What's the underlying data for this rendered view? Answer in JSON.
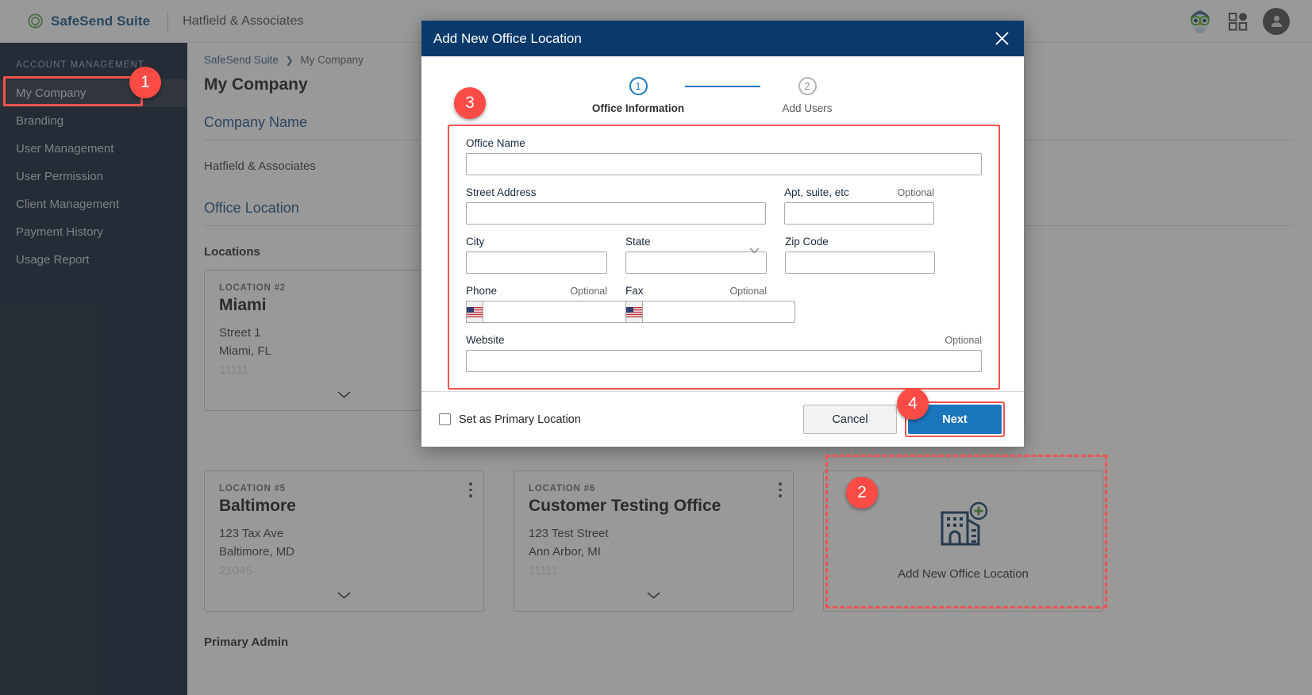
{
  "topbar": {
    "brand_name": "SafeSend Suite",
    "firm_name": "Hatfield & Associates",
    "icons": {
      "mascot": "owl-mascot-icon",
      "apps": "apps-grid-icon",
      "account": "user-avatar-icon"
    }
  },
  "sidebar": {
    "heading": "ACCOUNT MANAGEMENT",
    "items": [
      {
        "label": "My Company",
        "active": true
      },
      {
        "label": "Branding",
        "active": false
      },
      {
        "label": "User Management",
        "active": false
      },
      {
        "label": "User Permission",
        "active": false
      },
      {
        "label": "Client Management",
        "active": false
      },
      {
        "label": "Payment History",
        "active": false
      },
      {
        "label": "Usage Report",
        "active": false
      }
    ]
  },
  "main": {
    "breadcrumb": {
      "root": "SafeSend Suite",
      "separator": "❯",
      "current": "My Company"
    },
    "page_title": "My Company",
    "company_section_title": "Company Name",
    "company_value": "Hatfield & Associates",
    "office_section_title": "Office Location",
    "locations_label": "Locations",
    "primary_admin_label": "Primary Admin",
    "cards": [
      {
        "number": "LOCATION #2",
        "name": "Miami",
        "street": "Street 1",
        "city_state": "Miami, FL",
        "zip": "11111"
      },
      {
        "number": "LOCATION #5",
        "name": "Baltimore",
        "street": "123 Tax Ave",
        "city_state": "Baltimore, MD",
        "zip": "21045"
      },
      {
        "number": "LOCATION #6",
        "name": "Customer Testing Office",
        "street": "123 Test Street",
        "city_state": "Ann Arbor, MI",
        "zip": "11111"
      }
    ],
    "add_card": {
      "label": "Add New Office Location",
      "icon": "building-plus-icon"
    }
  },
  "modal": {
    "title": "Add New Office Location",
    "close_icon": "close-icon",
    "steps": [
      {
        "number": "1",
        "label": "Office Information",
        "state": "active"
      },
      {
        "number": "2",
        "label": "Add Users",
        "state": "pending"
      }
    ],
    "fields": {
      "office_name": {
        "label": "Office Name",
        "value": "",
        "optional": ""
      },
      "street": {
        "label": "Street Address",
        "value": "",
        "optional": ""
      },
      "apt": {
        "label": "Apt, suite, etc",
        "value": "",
        "optional": "Optional"
      },
      "city": {
        "label": "City",
        "value": "",
        "optional": ""
      },
      "state": {
        "label": "State",
        "value": "",
        "optional": ""
      },
      "zip": {
        "label": "Zip Code",
        "value": "",
        "optional": ""
      },
      "phone": {
        "label": "Phone",
        "value": "",
        "optional": "Optional",
        "country_flag": "us-flag-icon"
      },
      "fax": {
        "label": "Fax",
        "value": "",
        "optional": "Optional",
        "country_flag": "us-flag-icon"
      },
      "website": {
        "label": "Website",
        "value": "",
        "optional": "Optional"
      }
    },
    "footer": {
      "primary_checkbox_label": "Set as Primary Location",
      "primary_checkbox_checked": false,
      "cancel_label": "Cancel",
      "next_label": "Next"
    }
  },
  "annotations": {
    "badges": [
      {
        "id": "1",
        "target": "sidebar-item-my-company"
      },
      {
        "id": "2",
        "target": "add-new-office-location-card"
      },
      {
        "id": "3",
        "target": "office-information-form"
      },
      {
        "id": "4",
        "target": "next-button"
      }
    ]
  },
  "colors": {
    "brand_blue": "#14527f",
    "modal_header": "#0a3a6b",
    "primary_button": "#1b75bb",
    "annotation_red": "#fb4b45",
    "sidebar_bg": "#0f1d2e",
    "step_active": "#1b7ac2"
  }
}
